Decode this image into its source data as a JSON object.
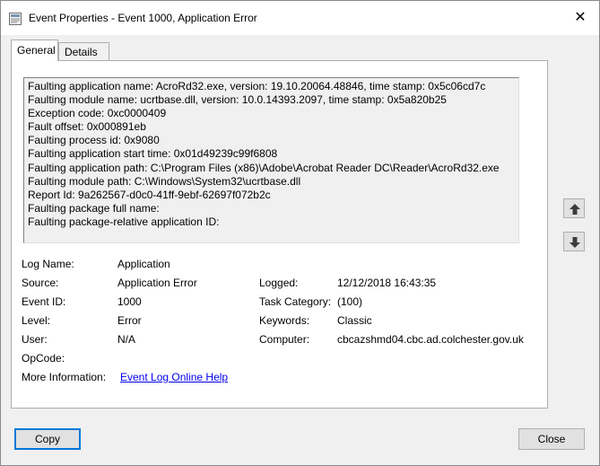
{
  "window": {
    "title": "Event Properties - Event 1000, Application Error",
    "close_glyph": "✕"
  },
  "tabs": [
    {
      "label": "General",
      "active": true
    },
    {
      "label": "Details",
      "active": false
    }
  ],
  "description_lines": [
    "Faulting application name: AcroRd32.exe, version: 19.10.20064.48846, time stamp: 0x5c06cd7c",
    "Faulting module name: ucrtbase.dll, version: 10.0.14393.2097, time stamp: 0x5a820b25",
    "Exception code: 0xc0000409",
    "Fault offset: 0x000891eb",
    "Faulting process id: 0x9080",
    "Faulting application start time: 0x01d49239c99f6808",
    "Faulting application path: C:\\Program Files (x86)\\Adobe\\Acrobat Reader DC\\Reader\\AcroRd32.exe",
    "Faulting module path: C:\\Windows\\System32\\ucrtbase.dll",
    "Report Id: 9a262567-d0c0-41ff-9ebf-62697f072b2c",
    "Faulting package full name:",
    "Faulting package-relative application ID:"
  ],
  "fields": {
    "log_name_label": "Log Name:",
    "log_name_value": "Application",
    "source_label": "Source:",
    "source_value": "Application Error",
    "logged_label": "Logged:",
    "logged_value": "12/12/2018 16:43:35",
    "event_id_label": "Event ID:",
    "event_id_value": "1000",
    "task_category_label": "Task Category:",
    "task_category_value": "(100)",
    "level_label": "Level:",
    "level_value": "Error",
    "keywords_label": "Keywords:",
    "keywords_value": "Classic",
    "user_label": "User:",
    "user_value": "N/A",
    "computer_label": "Computer:",
    "computer_value": "cbcazshmd04.cbc.ad.colchester.gov.uk",
    "opcode_label": "OpCode:",
    "opcode_value": "",
    "more_info_label": "More Information:",
    "more_info_link": "Event Log Online Help"
  },
  "buttons": {
    "copy": "Copy",
    "close": "Close"
  },
  "icons": {
    "title_icon": "event-properties-icon",
    "up": "arrow-up-icon",
    "down": "arrow-down-icon"
  },
  "colors": {
    "link": "#0000ee",
    "focus_border": "#0078d7"
  }
}
